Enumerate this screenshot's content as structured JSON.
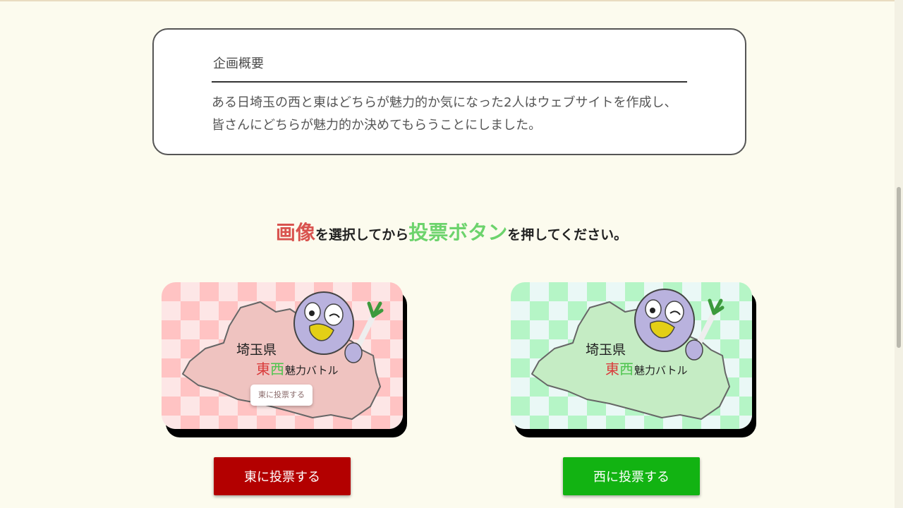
{
  "overview": {
    "title": "企画概要",
    "body_line1": "ある日埼玉の西と東はどちらが魅力的か気になった2人はウェブサイトを作成し、",
    "body_line2": "皆さんにどちらが魅力的か決めてもらうことにしました。"
  },
  "instruction": {
    "part1": "画像",
    "part2": "を選択してから",
    "part3": "投票ボタン",
    "part4": "を押してください。"
  },
  "cards": {
    "east": {
      "title_line1": "埼玉県",
      "title_east": "東",
      "title_west": "西",
      "title_rest": "魅力バトル",
      "mini_button": "東に投票する"
    },
    "west": {
      "title_line1": "埼玉県",
      "title_east": "東",
      "title_west": "西",
      "title_rest": "魅力バトル"
    }
  },
  "buttons": {
    "vote_east": "東に投票する",
    "vote_west": "西に投票する"
  },
  "colors": {
    "background": "#fcfbee",
    "accent_red": "#d9534f",
    "accent_green": "#6cd36c",
    "vote_east": "#b30000",
    "vote_west": "#12b312"
  }
}
